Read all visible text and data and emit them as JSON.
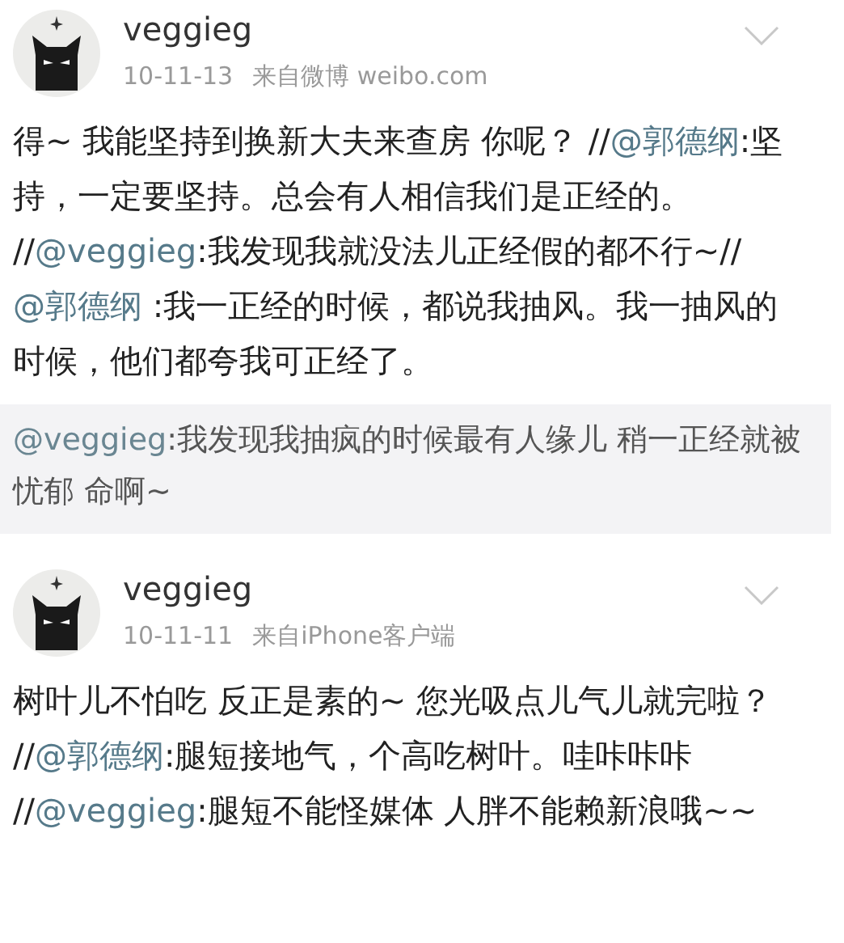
{
  "posts": [
    {
      "user": "veggieg",
      "time": "10-11-13",
      "source": "来自微博 weibo.com",
      "text": [
        {
          "kind": "text",
          "text": "得~ 我能坚持到换新大夫来查房 你呢？ //"
        },
        {
          "kind": "mention",
          "text": "@郭德纲"
        },
        {
          "kind": "text",
          "text": ":坚持，一定要坚持。总会有人相信我们是正经的。 //"
        },
        {
          "kind": "mention",
          "text": "@veggieg"
        },
        {
          "kind": "text",
          "text": ":我发现我就没法儿正经假的都不行~// "
        },
        {
          "kind": "mention",
          "text": "@郭德纲"
        },
        {
          "kind": "text",
          "text": " :我一正经的时候，都说我抽风。我一抽风的时候，他们都夸我可正经了。"
        }
      ],
      "quote": [
        {
          "kind": "mention",
          "text": "@veggieg"
        },
        {
          "kind": "text",
          "text": ":我发现我抽疯的时候最有人缘儿 稍一正经就被忧郁 命啊~"
        }
      ]
    },
    {
      "user": "veggieg",
      "time": "10-11-11",
      "source": "来自iPhone客户端",
      "text": [
        {
          "kind": "text",
          "text": "树叶儿不怕吃 反正是素的~ 您光吸点儿气儿就完啦？ //"
        },
        {
          "kind": "mention",
          "text": "@郭德纲"
        },
        {
          "kind": "text",
          "text": ":腿短接地气，个高吃树叶。哇咔咔咔 //"
        },
        {
          "kind": "mention",
          "text": "@veggieg"
        },
        {
          "kind": "text",
          "text": ":腿短不能怪媒体 人胖不能赖新浪哦~~"
        }
      ]
    }
  ]
}
